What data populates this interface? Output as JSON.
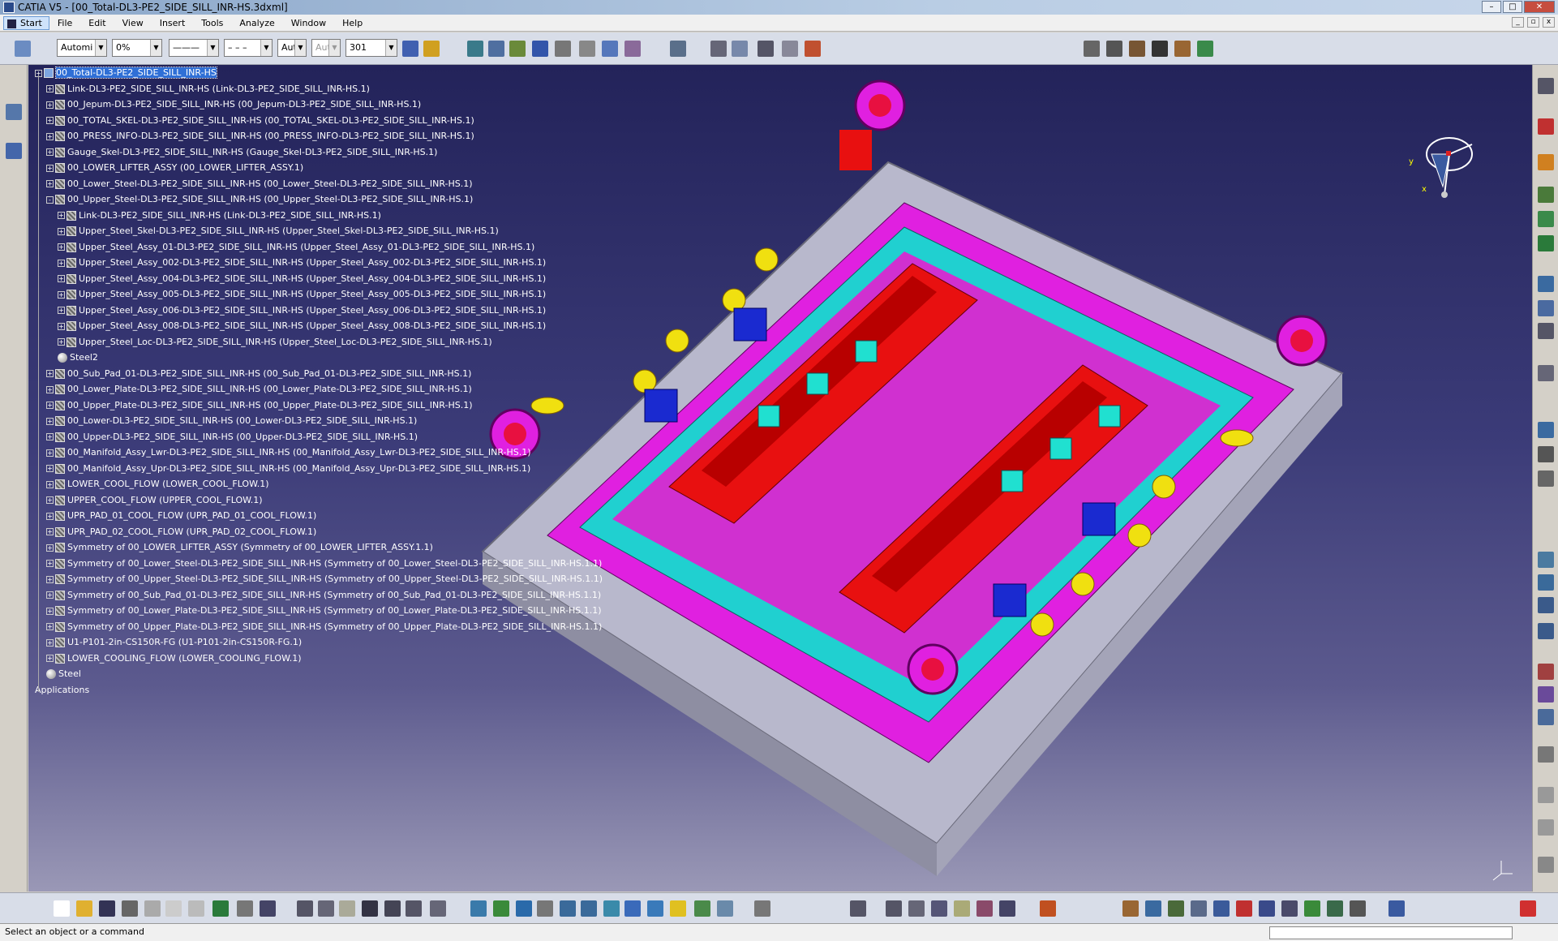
{
  "window": {
    "title": "CATIA V5 - [00_Total-DL3-PE2_SIDE_SILL_INR-HS.3dxml]"
  },
  "menu": [
    "Start",
    "File",
    "Edit",
    "View",
    "Insert",
    "Tools",
    "Analyze",
    "Window",
    "Help"
  ],
  "toolbar": {
    "auto_combo": "Automi",
    "percent_combo": "0%",
    "line_type": "———",
    "line_dash": "– – –",
    "layer_combo": "Aut",
    "layer_combo2": "Aut",
    "number_combo": "301"
  },
  "tree": [
    {
      "label": "00_Total-DL3-PE2_SIDE_SILL_INR-HS",
      "level": 0,
      "selected": true,
      "icon": "root"
    },
    {
      "label": "Link-DL3-PE2_SIDE_SILL_INR-HS (Link-DL3-PE2_SIDE_SILL_INR-HS.1)",
      "level": 1
    },
    {
      "label": "00_Jepum-DL3-PE2_SIDE_SILL_INR-HS (00_Jepum-DL3-PE2_SIDE_SILL_INR-HS.1)",
      "level": 1
    },
    {
      "label": "00_TOTAL_SKEL-DL3-PE2_SIDE_SILL_INR-HS (00_TOTAL_SKEL-DL3-PE2_SIDE_SILL_INR-HS.1)",
      "level": 1
    },
    {
      "label": "00_PRESS_INFO-DL3-PE2_SIDE_SILL_INR-HS (00_PRESS_INFO-DL3-PE2_SIDE_SILL_INR-HS.1)",
      "level": 1
    },
    {
      "label": "Gauge_Skel-DL3-PE2_SIDE_SILL_INR-HS (Gauge_Skel-DL3-PE2_SIDE_SILL_INR-HS.1)",
      "level": 1
    },
    {
      "label": "00_LOWER_LIFTER_ASSY (00_LOWER_LIFTER_ASSY.1)",
      "level": 1
    },
    {
      "label": "00_Lower_Steel-DL3-PE2_SIDE_SILL_INR-HS (00_Lower_Steel-DL3-PE2_SIDE_SILL_INR-HS.1)",
      "level": 1
    },
    {
      "label": "00_Upper_Steel-DL3-PE2_SIDE_SILL_INR-HS (00_Upper_Steel-DL3-PE2_SIDE_SILL_INR-HS.1)",
      "level": 1,
      "expanded": true
    },
    {
      "label": "Link-DL3-PE2_SIDE_SILL_INR-HS (Link-DL3-PE2_SIDE_SILL_INR-HS.1)",
      "level": 2
    },
    {
      "label": "Upper_Steel_Skel-DL3-PE2_SIDE_SILL_INR-HS (Upper_Steel_Skel-DL3-PE2_SIDE_SILL_INR-HS.1)",
      "level": 2
    },
    {
      "label": "Upper_Steel_Assy_01-DL3-PE2_SIDE_SILL_INR-HS (Upper_Steel_Assy_01-DL3-PE2_SIDE_SILL_INR-HS.1)",
      "level": 2
    },
    {
      "label": "Upper_Steel_Assy_002-DL3-PE2_SIDE_SILL_INR-HS (Upper_Steel_Assy_002-DL3-PE2_SIDE_SILL_INR-HS.1)",
      "level": 2
    },
    {
      "label": "Upper_Steel_Assy_004-DL3-PE2_SIDE_SILL_INR-HS (Upper_Steel_Assy_004-DL3-PE2_SIDE_SILL_INR-HS.1)",
      "level": 2
    },
    {
      "label": "Upper_Steel_Assy_005-DL3-PE2_SIDE_SILL_INR-HS (Upper_Steel_Assy_005-DL3-PE2_SIDE_SILL_INR-HS.1)",
      "level": 2
    },
    {
      "label": "Upper_Steel_Assy_006-DL3-PE2_SIDE_SILL_INR-HS (Upper_Steel_Assy_006-DL3-PE2_SIDE_SILL_INR-HS.1)",
      "level": 2
    },
    {
      "label": "Upper_Steel_Assy_008-DL3-PE2_SIDE_SILL_INR-HS (Upper_Steel_Assy_008-DL3-PE2_SIDE_SILL_INR-HS.1)",
      "level": 2
    },
    {
      "label": "Upper_Steel_Loc-DL3-PE2_SIDE_SILL_INR-HS (Upper_Steel_Loc-DL3-PE2_SIDE_SILL_INR-HS.1)",
      "level": 2
    },
    {
      "label": "Steel2",
      "level": 2,
      "icon": "ball"
    },
    {
      "label": "00_Sub_Pad_01-DL3-PE2_SIDE_SILL_INR-HS (00_Sub_Pad_01-DL3-PE2_SIDE_SILL_INR-HS.1)",
      "level": 1
    },
    {
      "label": "00_Lower_Plate-DL3-PE2_SIDE_SILL_INR-HS (00_Lower_Plate-DL3-PE2_SIDE_SILL_INR-HS.1)",
      "level": 1
    },
    {
      "label": "00_Upper_Plate-DL3-PE2_SIDE_SILL_INR-HS (00_Upper_Plate-DL3-PE2_SIDE_SILL_INR-HS.1)",
      "level": 1
    },
    {
      "label": "00_Lower-DL3-PE2_SIDE_SILL_INR-HS (00_Lower-DL3-PE2_SIDE_SILL_INR-HS.1)",
      "level": 1
    },
    {
      "label": "00_Upper-DL3-PE2_SIDE_SILL_INR-HS (00_Upper-DL3-PE2_SIDE_SILL_INR-HS.1)",
      "level": 1
    },
    {
      "label": "00_Manifold_Assy_Lwr-DL3-PE2_SIDE_SILL_INR-HS (00_Manifold_Assy_Lwr-DL3-PE2_SIDE_SILL_INR-HS.1)",
      "level": 1
    },
    {
      "label": "00_Manifold_Assy_Upr-DL3-PE2_SIDE_SILL_INR-HS (00_Manifold_Assy_Upr-DL3-PE2_SIDE_SILL_INR-HS.1)",
      "level": 1
    },
    {
      "label": "LOWER_COOL_FLOW (LOWER_COOL_FLOW.1)",
      "level": 1
    },
    {
      "label": "UPPER_COOL_FLOW (UPPER_COOL_FLOW.1)",
      "level": 1
    },
    {
      "label": "UPR_PAD_01_COOL_FLOW (UPR_PAD_01_COOL_FLOW.1)",
      "level": 1
    },
    {
      "label": "UPR_PAD_02_COOL_FLOW (UPR_PAD_02_COOL_FLOW.1)",
      "level": 1
    },
    {
      "label": "Symmetry of 00_LOWER_LIFTER_ASSY (Symmetry of 00_LOWER_LIFTER_ASSY.1.1)",
      "level": 1
    },
    {
      "label": "Symmetry of 00_Lower_Steel-DL3-PE2_SIDE_SILL_INR-HS (Symmetry of 00_Lower_Steel-DL3-PE2_SIDE_SILL_INR-HS.1.1)",
      "level": 1
    },
    {
      "label": "Symmetry of 00_Upper_Steel-DL3-PE2_SIDE_SILL_INR-HS (Symmetry of 00_Upper_Steel-DL3-PE2_SIDE_SILL_INR-HS.1.1)",
      "level": 1
    },
    {
      "label": "Symmetry of 00_Sub_Pad_01-DL3-PE2_SIDE_SILL_INR-HS (Symmetry of 00_Sub_Pad_01-DL3-PE2_SIDE_SILL_INR-HS.1.1)",
      "level": 1
    },
    {
      "label": "Symmetry of 00_Lower_Plate-DL3-PE2_SIDE_SILL_INR-HS (Symmetry of 00_Lower_Plate-DL3-PE2_SIDE_SILL_INR-HS.1.1)",
      "level": 1
    },
    {
      "label": "Symmetry of 00_Upper_Plate-DL3-PE2_SIDE_SILL_INR-HS (Symmetry of 00_Upper_Plate-DL3-PE2_SIDE_SILL_INR-HS.1.1)",
      "level": 1
    },
    {
      "label": "U1-P101-2in-CS150R-FG (U1-P101-2in-CS150R-FG.1)",
      "level": 1
    },
    {
      "label": "LOWER_COOLING_FLOW (LOWER_COOLING_FLOW.1)",
      "level": 1
    },
    {
      "label": "Steel",
      "level": 1,
      "icon": "ball"
    },
    {
      "label": "Applications",
      "level": 0,
      "icon": "none"
    }
  ],
  "compass": {
    "axis_x": "x",
    "axis_y": "y"
  },
  "status": {
    "message": "Select an object or a command"
  },
  "colors": {
    "viewport_top": "#23235a",
    "viewport_bottom": "#9a98b6",
    "selection": "#2f6fd6"
  }
}
